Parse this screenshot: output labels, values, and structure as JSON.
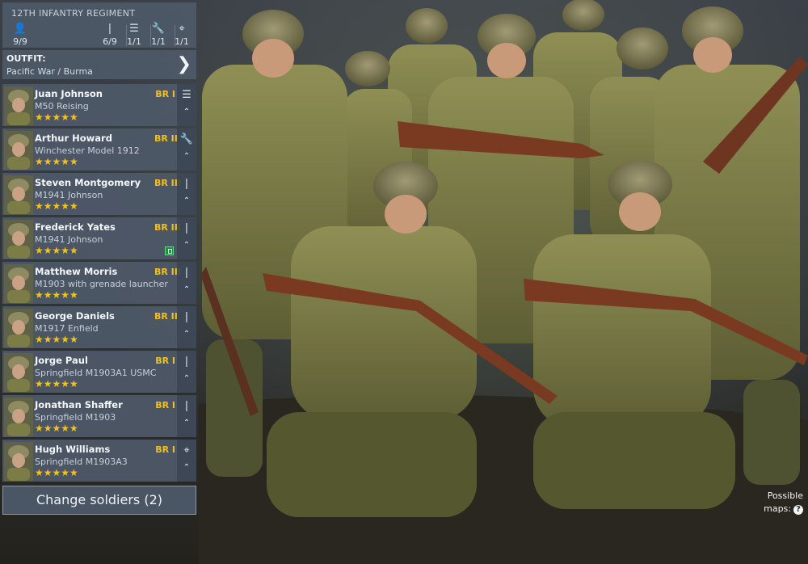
{
  "regiment": {
    "title": "12TH INFANTRY REGIMENT",
    "stats": [
      {
        "icon": "person-icon",
        "glyph": "👤",
        "value": "9/9"
      },
      {
        "icon": "bullet-icon",
        "glyph": "❘",
        "value": "6/9"
      },
      {
        "icon": "list-icon",
        "glyph": "☰",
        "value": "1/1"
      },
      {
        "icon": "wrench-icon",
        "glyph": "🔧",
        "value": "1/1"
      },
      {
        "icon": "crosshair-icon",
        "glyph": "⌖",
        "value": "1/1"
      }
    ]
  },
  "outfit": {
    "label": "OUTFIT:",
    "value": "Pacific War / Burma",
    "chevron": "❯"
  },
  "soldiers": [
    {
      "name": "Juan Johnson",
      "weapon": "M50 Reising",
      "rank": "BR I",
      "stars": "★★★★★",
      "role_icon": "list-icon",
      "role_glyph": "☰",
      "up": "⌃"
    },
    {
      "name": "Arthur Howard",
      "weapon": "Winchester Model 1912",
      "rank": "BR II",
      "stars": "★★★★★",
      "role_icon": "wrench-icon",
      "role_glyph": "🔧",
      "up": "⌃"
    },
    {
      "name": "Steven Montgomery",
      "weapon": "M1941 Johnson",
      "rank": "BR III",
      "stars": "★★★★★",
      "role_icon": "bullet-icon",
      "role_glyph": "❘",
      "up": "⌃"
    },
    {
      "name": "Frederick Yates",
      "weapon": "M1941 Johnson",
      "rank": "BR III",
      "stars": "★★★★★",
      "role_icon": "bullet-icon",
      "role_glyph": "❘",
      "up": "⌃"
    },
    {
      "name": "Matthew Morris",
      "weapon": "M1903 with grenade launcher",
      "rank": "BR III",
      "stars": "★★★★★",
      "role_icon": "bullet-icon",
      "role_glyph": "❘",
      "up": "⌃"
    },
    {
      "name": "George Daniels",
      "weapon": "M1917 Enfield",
      "rank": "BR II",
      "stars": "★★★★★",
      "role_icon": "bullet-icon",
      "role_glyph": "❘",
      "up": "⌃"
    },
    {
      "name": "Jorge Paul",
      "weapon": "Springfield M1903A1 USMC",
      "rank": "BR I",
      "stars": "★★★★★",
      "role_icon": "bullet-icon",
      "role_glyph": "❘",
      "up": "⌃"
    },
    {
      "name": "Jonathan Shaffer",
      "weapon": "Springfield M1903",
      "rank": "BR I",
      "stars": "★★★★★",
      "role_icon": "bullet-icon",
      "role_glyph": "❘",
      "up": "⌃"
    },
    {
      "name": "Hugh Williams",
      "weapon": "Springfield M1903A3",
      "rank": "BR I",
      "stars": "★★★★★",
      "role_icon": "crosshair-icon",
      "role_glyph": "⌖",
      "up": "⌃"
    }
  ],
  "change_soldiers": "Change soldiers (2)",
  "possible_maps": {
    "line1": "Possible",
    "line2": "maps:",
    "help": "?"
  },
  "colors": {
    "accent_gold": "#f0c020",
    "panel": "#4f5a6a",
    "uniform": "#8b8a4e",
    "rifle": "#7a3a22"
  }
}
